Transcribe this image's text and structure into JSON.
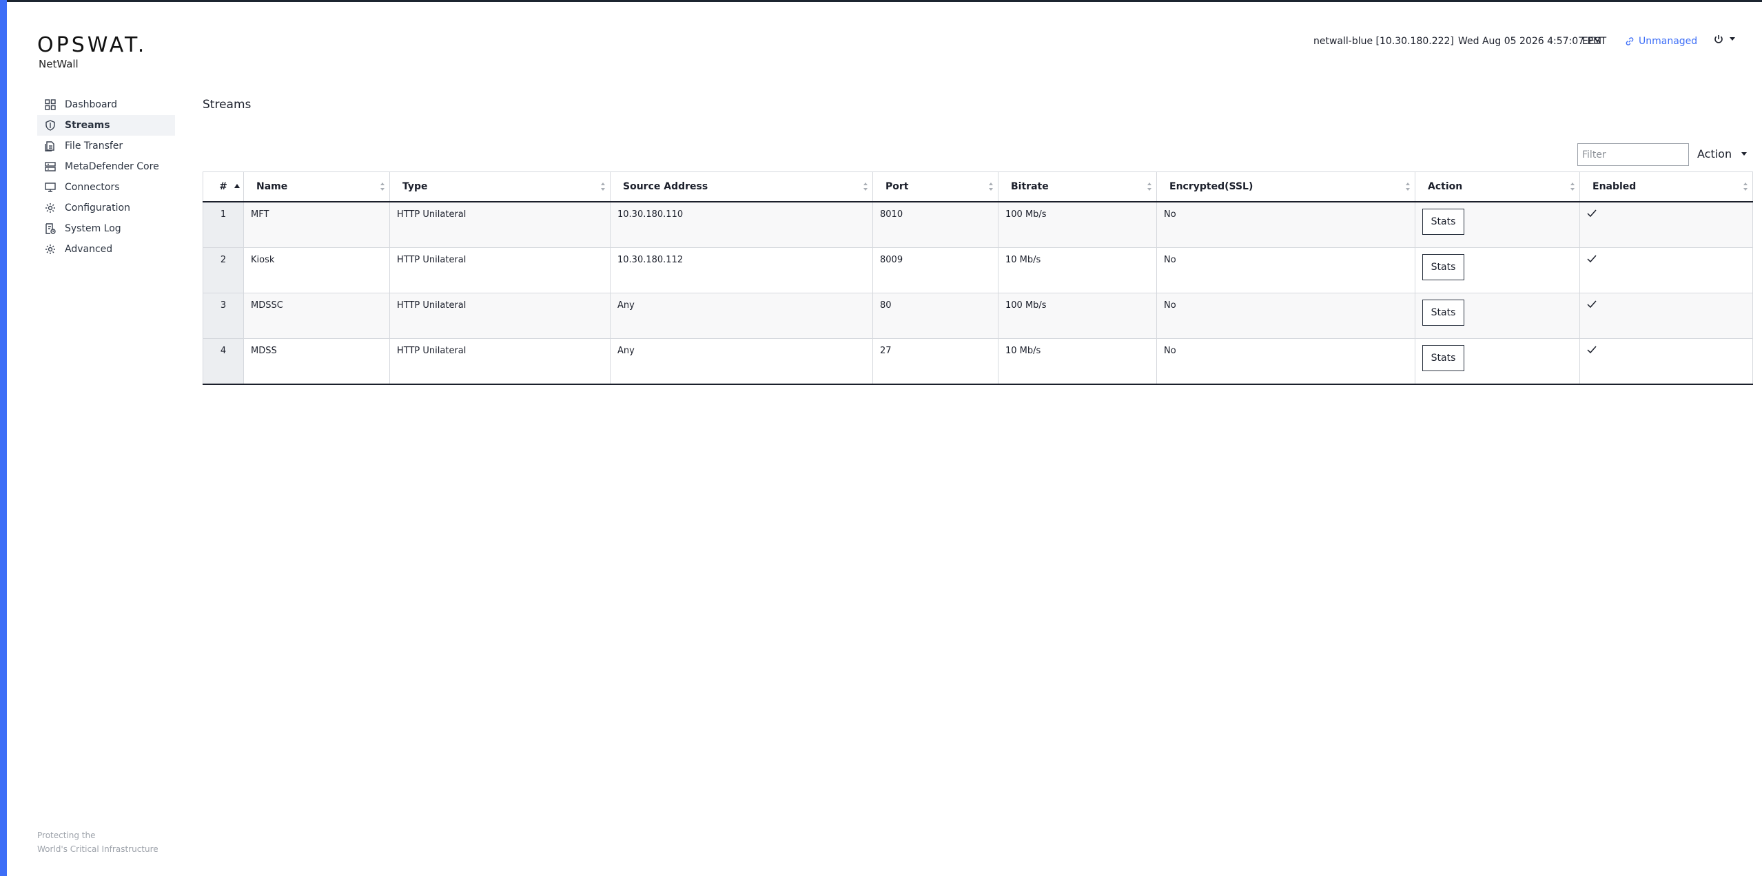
{
  "brand": {
    "logo": "OPSWAT.",
    "product": "NetWall"
  },
  "header": {
    "host": "netwall-blue [10.30.180.222]",
    "datetime": "Wed Aug 05 2026 4:57:07 PM",
    "timezone": "EEST",
    "management_status": "Unmanaged"
  },
  "sidebar": {
    "items": [
      {
        "label": "Dashboard",
        "icon": "dashboard-icon",
        "active": false
      },
      {
        "label": "Streams",
        "icon": "shield-icon",
        "active": true
      },
      {
        "label": "File Transfer",
        "icon": "file-transfer-icon",
        "active": false
      },
      {
        "label": "MetaDefender Core",
        "icon": "server-icon",
        "active": false
      },
      {
        "label": "Connectors",
        "icon": "monitor-icon",
        "active": false
      },
      {
        "label": "Configuration",
        "icon": "gear-icon",
        "active": false
      },
      {
        "label": "System Log",
        "icon": "log-icon",
        "active": false
      },
      {
        "label": "Advanced",
        "icon": "gear-icon",
        "active": false
      }
    ]
  },
  "footer": {
    "line1": "Protecting the",
    "line2": "World's Critical Infrastructure"
  },
  "main": {
    "title": "Streams",
    "filter_placeholder": "Filter",
    "action_label": "Action",
    "columns": [
      "#",
      "Name",
      "Type",
      "Source Address",
      "Port",
      "Bitrate",
      "Encrypted(SSL)",
      "Action",
      "Enabled"
    ],
    "sorted_column": "#",
    "rows": [
      {
        "num": "1",
        "name": "MFT",
        "type": "HTTP Unilateral",
        "source": "10.30.180.110",
        "port": "8010",
        "bitrate": "100 Mb/s",
        "encrypted": "No",
        "action": "Stats",
        "enabled": true
      },
      {
        "num": "2",
        "name": "Kiosk",
        "type": "HTTP Unilateral",
        "source": "10.30.180.112",
        "port": "8009",
        "bitrate": "10 Mb/s",
        "encrypted": "No",
        "action": "Stats",
        "enabled": true
      },
      {
        "num": "3",
        "name": "MDSSC",
        "type": "HTTP Unilateral",
        "source": "Any",
        "port": "80",
        "bitrate": "100 Mb/s",
        "encrypted": "No",
        "action": "Stats",
        "enabled": true
      },
      {
        "num": "4",
        "name": "MDSS",
        "type": "HTTP Unilateral",
        "source": "Any",
        "port": "27",
        "bitrate": "10 Mb/s",
        "encrypted": "No",
        "action": "Stats",
        "enabled": true
      }
    ]
  },
  "colors": {
    "accent": "#3d6ef7",
    "text": "#1b1f2b",
    "muted": "#9ea3ab"
  }
}
